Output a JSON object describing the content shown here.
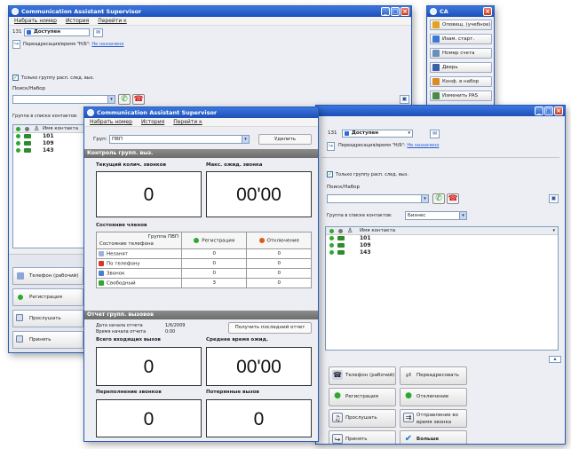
{
  "back_window": {
    "title": "Communication Assistant Supervisor",
    "menu": [
      "Набрать номер",
      "История",
      "Перейти к"
    ],
    "ext_number": "131",
    "presence": "Доступен",
    "forward_label": "Переадресация/время \"Н/Б\":",
    "forward_link": "Не назначено",
    "only_group_label": "Только группу расп. след. выз.",
    "search_label": "Поиск/Набор",
    "group_label": "Группа в списке контактов:",
    "contacts_header": "Имя контакта",
    "contacts": [
      "101",
      "109",
      "143"
    ],
    "buttons": [
      "Телефон (рабочий)",
      "Регистрация",
      "Прослушать",
      "Принять"
    ]
  },
  "mini_window": {
    "title": "CA",
    "buttons": [
      "Оповещ. (учебное)",
      "Изам. старт.",
      "Номер счета",
      "Дверь",
      "Конф. в набор",
      "Изменить PAS"
    ]
  },
  "main_window": {
    "title": "Communication Assistant Supervisor",
    "menu": [
      "Набрать номер",
      "История",
      "Перейти к"
    ],
    "group_label": "Груп:",
    "group_value": "ПВП",
    "exit_button": "Уделить",
    "section_control": "Контроль групп. выз.",
    "current_calls_label": "Текущий колич. звонков",
    "current_calls_value": "0",
    "max_wait_label": "Макс. ожид. звонка",
    "max_wait_value": "00'00",
    "member_state_label": "Состояние членов",
    "table": {
      "group_header": "Группа ПВП",
      "state_header": "Состояние телефона",
      "col_registration": "Регистрация",
      "col_disconnected": "Отключение",
      "rows": [
        {
          "label": "Незанят",
          "reg": "0",
          "off": "0"
        },
        {
          "label": "По телефону",
          "reg": "0",
          "off": "0"
        },
        {
          "label": "Звонок",
          "reg": "0",
          "off": "0"
        },
        {
          "label": "Свободный",
          "reg": "3",
          "off": "0"
        }
      ]
    },
    "section_report": "Отчет групп. вызовов",
    "report_date_label": "Дата начала отчета",
    "report_date_value": "1/6/2009",
    "report_time_label": "Время начала отчета",
    "report_time_value": "0:00",
    "last_report_button": "Получить последний отчет",
    "incoming_label": "Всего входящих вызов",
    "incoming_value": "0",
    "avg_wait_label": "Среднее время ожид.",
    "avg_wait_value": "00'00",
    "overflow_label": "Переполнение звонков",
    "overflow_value": "0",
    "lost_label": "Потерянные вызов",
    "lost_value": "0"
  },
  "right_window": {
    "ext_number": "131",
    "presence": "Доступен",
    "forward_label": "Переадресация/время \"Н/Б\":",
    "forward_link": "Не назначено",
    "only_group_label": "Только группу расп. след. выз.",
    "search_label": "Поиск/Набор",
    "group_label": "Группа в списке контактов:",
    "group_value": "Бизнес",
    "contacts_header": "Имя контакта",
    "contacts": [
      "101",
      "109",
      "143"
    ],
    "buttons": [
      "Телефон (рабочий)",
      "Переадресовать",
      "Регистрация",
      "Отключение",
      "Прослушать",
      "Отправление во время звонка",
      "Принять",
      "Больше"
    ]
  }
}
